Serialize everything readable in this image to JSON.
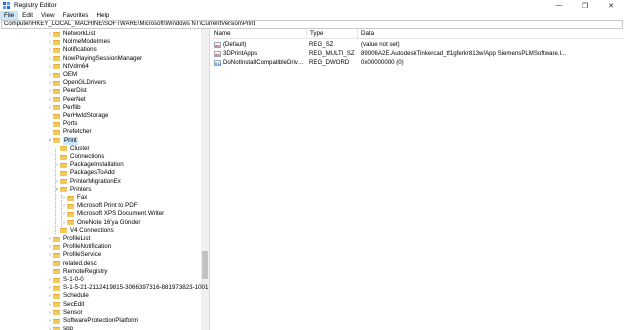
{
  "window": {
    "title": "Registry Editor"
  },
  "menu": [
    "File",
    "Edit",
    "View",
    "Favorites",
    "Help"
  ],
  "address": "Computer\\HKEY_LOCAL_MACHINE\\SOFTWARE\\Microsoft\\Windows NT\\CurrentVersion\\Print",
  "tree": [
    {
      "label": "NetworkList",
      "level": 0,
      "chevron": ">"
    },
    {
      "label": "NoImeModeImes",
      "level": 0,
      "chevron": ">"
    },
    {
      "label": "Notifications",
      "level": 0,
      "chevron": ">"
    },
    {
      "label": "NowPlayingSessionManager",
      "level": 0,
      "chevron": ">"
    },
    {
      "label": "NtVdm64",
      "level": 0,
      "chevron": ">"
    },
    {
      "label": "OEM",
      "level": 0,
      "chevron": ">"
    },
    {
      "label": "OpenGLDrivers",
      "level": 0,
      "chevron": ">"
    },
    {
      "label": "PeerDist",
      "level": 0,
      "chevron": ">"
    },
    {
      "label": "PeerNet",
      "level": 0,
      "chevron": ">"
    },
    {
      "label": "Perflib",
      "level": 0,
      "chevron": ">"
    },
    {
      "label": "PerHwIdStorage",
      "level": 0,
      "chevron": ""
    },
    {
      "label": "Ports",
      "level": 0,
      "chevron": ""
    },
    {
      "label": "Prefetcher",
      "level": 0,
      "chevron": ""
    },
    {
      "label": "Print",
      "level": 0,
      "chevron": "v",
      "selected": true
    },
    {
      "label": "Cluster",
      "level": 1,
      "chevron": ""
    },
    {
      "label": "Connections",
      "level": 1,
      "chevron": ""
    },
    {
      "label": "PackageInstallation",
      "level": 1,
      "chevron": ">"
    },
    {
      "label": "PackagesToAdd",
      "level": 1,
      "chevron": ""
    },
    {
      "label": "PrinterMigrationEx",
      "level": 1,
      "chevron": ">"
    },
    {
      "label": "Printers",
      "level": 1,
      "chevron": "v"
    },
    {
      "label": "Fax",
      "level": 2,
      "chevron": ">"
    },
    {
      "label": "Microsoft Print to PDF",
      "level": 2,
      "chevron": ">"
    },
    {
      "label": "Microsoft XPS Document Writer",
      "level": 2,
      "chevron": ">"
    },
    {
      "label": "OneNote 16'ya Gönder",
      "level": 2,
      "chevron": ">"
    },
    {
      "label": "V4 Connections",
      "level": 1,
      "chevron": ""
    },
    {
      "label": "ProfileList",
      "level": 0,
      "chevron": ">"
    },
    {
      "label": "ProfileNotification",
      "level": 0,
      "chevron": ">"
    },
    {
      "label": "ProfileService",
      "level": 0,
      "chevron": ">"
    },
    {
      "label": "related.desc",
      "level": 0,
      "chevron": ""
    },
    {
      "label": "RemoteRegistry",
      "level": 0,
      "chevron": ""
    },
    {
      "label": "S-1-0-0",
      "level": 0,
      "chevron": ">"
    },
    {
      "label": "S-1-5-21-2112419815-3066397316-881973823-1001",
      "level": 0,
      "chevron": ">"
    },
    {
      "label": "Schedule",
      "level": 0,
      "chevron": ">"
    },
    {
      "label": "SecEdit",
      "level": 0,
      "chevron": ">"
    },
    {
      "label": "Sensor",
      "level": 0,
      "chevron": ">"
    },
    {
      "label": "SoftwareProtectionPlatform",
      "level": 0,
      "chevron": ">"
    },
    {
      "label": "spp",
      "level": 0,
      "chevron": ">"
    }
  ],
  "columns": {
    "name": "Name",
    "type": "Type",
    "data": "Data"
  },
  "values": [
    {
      "name": "(Default)",
      "type": "REG_SZ",
      "data": "(value not set)",
      "icon": "ab"
    },
    {
      "name": "3DPrintApps",
      "type": "REG_MULTI_SZ",
      "data": "89006A2E.AutodeskTinkercad_tf1gferkr813w!App SiemensPLMSoftware.l...",
      "icon": "ab"
    },
    {
      "name": "DoNotInstallCompatibleDriverFro...",
      "type": "REG_DWORD",
      "data": "0x00000000 (0)",
      "icon": "011"
    }
  ]
}
